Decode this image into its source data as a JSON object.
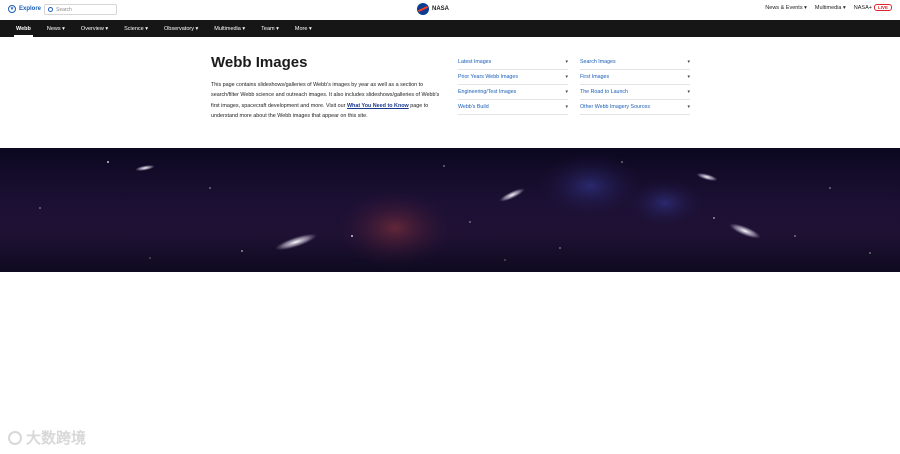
{
  "topbar": {
    "explore_label": "Explore",
    "search_placeholder": "Search",
    "brand": "NASA",
    "right_links": [
      "News & Events ▾",
      "Multimedia ▾",
      "NASA+"
    ],
    "live_badge": "LIVE"
  },
  "nav": {
    "items": [
      "Webb",
      "News ▾",
      "Overview ▾",
      "Science ▾",
      "Observatory ▾",
      "Multimedia ▾",
      "Team ▾",
      "More ▾"
    ]
  },
  "intro": {
    "title": "Webb Images",
    "desc_before": "This page contains slideshows/galleries of Webb's images by year as well as a section to search/filter Webb science and outreach images. It also includes slideshows/galleries of Webb's first images, spacecraft development and more. Visit our ",
    "desc_link": "What You Need to Know",
    "desc_after": " page to understand more about the Webb images that appear on this site."
  },
  "links": [
    {
      "label": "Latest Images"
    },
    {
      "label": "Search Images"
    },
    {
      "label": "Prior Years Webb Images"
    },
    {
      "label": "First Images"
    },
    {
      "label": "Engineering/Test Images"
    },
    {
      "label": "The Road to Launch"
    },
    {
      "label": "Webb's Build"
    },
    {
      "label": "Other Webb Imagery Sources"
    }
  ],
  "link_arrow": "▾",
  "watermark": "大数跨境",
  "colors": {
    "nav_bg": "#161616",
    "link": "#1a5eb8",
    "nasa_blue": "#0b3d91",
    "nasa_red": "#fc3d21",
    "live_red": "#e0262b"
  }
}
